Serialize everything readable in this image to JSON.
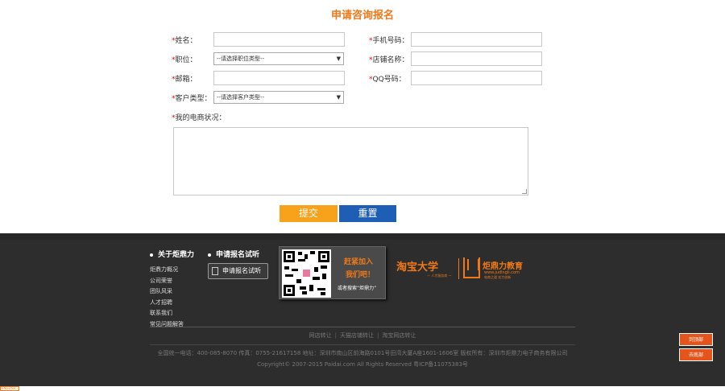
{
  "form": {
    "title": "申请咨询报名",
    "name_label": "姓名：",
    "phone_label": "手机号码：",
    "position_label": "职位：",
    "position_select": "--请选择职位类型--",
    "shop_label": "店铺名称：",
    "email_label": "邮箱：",
    "qq_label": "QQ号码：",
    "customer_type_label": "客户类型：",
    "customer_type_select": "--请选择客户类型--",
    "ecommerce_label": "我的电商状况：",
    "required_mark": "*",
    "submit_label": "提交",
    "reset_label": "重置"
  },
  "footer": {
    "about_heading": "关于炬鼎力",
    "apply_heading": "申请报名试听",
    "about_links": [
      "炬鼎力概况",
      "公司荣誉",
      "团队风采",
      "人才招聘",
      "联系我们",
      "常见问题解答"
    ],
    "apply_button": "申请报名试听",
    "qr_text1": "赶紧加入",
    "qr_text2": "我们吧！",
    "qr_text3_prefix": "或者搜索“",
    "qr_text3_name": "炬鼎力",
    "qr_text3_suffix": "”",
    "brand_taobao": "淘宝大学",
    "brand_taobao_sub": "— 人才服务商 —",
    "brand_jdl": "炬鼎力教育",
    "brand_url": "www.judingli.com",
    "brand_slogan": "电商之道 实力创新",
    "friend_links": [
      "网店转让",
      "天猫店铺转让",
      "淘宝网店转让"
    ],
    "hotline": "全国统一电话：400-085-8070 传真：0755-21617158 地址：深圳市南山区前海路0101号田湾大厦A座1601-1606室 版权所有：深圳市炬鼎力电子商务有限公司",
    "copyright": "Copyright© 2007-2015 Paidai.com All Rights Reserved 粤ICP备11075383号"
  },
  "side": {
    "top_label": "到顶部",
    "bottom_label": "去底部"
  },
  "bottom_tag": "ENGLISH"
}
